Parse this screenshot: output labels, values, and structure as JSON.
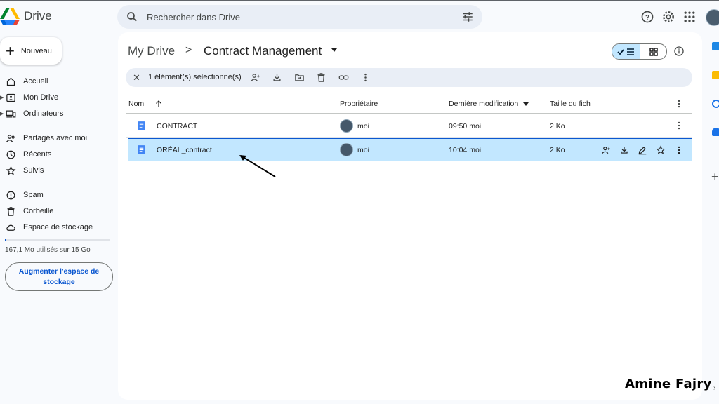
{
  "app": {
    "title": "Drive"
  },
  "search": {
    "placeholder": "Rechercher dans Drive"
  },
  "sidebar": {
    "new_label": "Nouveau",
    "items": [
      {
        "label": "Accueil",
        "icon": "home-icon"
      },
      {
        "label": "Mon Drive",
        "icon": "my-drive-icon"
      },
      {
        "label": "Ordinateurs",
        "icon": "computers-icon"
      },
      {
        "label": "Partagés avec moi",
        "icon": "shared-icon"
      },
      {
        "label": "Récents",
        "icon": "clock-icon"
      },
      {
        "label": "Suivis",
        "icon": "star-icon"
      },
      {
        "label": "Spam",
        "icon": "spam-icon"
      },
      {
        "label": "Corbeille",
        "icon": "trash-icon"
      },
      {
        "label": "Espace de stockage",
        "icon": "cloud-icon"
      }
    ],
    "storage_text": "167,1 Mo utilisés sur 15 Go",
    "storage_used_fraction": 0.011,
    "upgrade_label": "Augmenter l'espace de stockage"
  },
  "breadcrumb": {
    "root": "My Drive",
    "separator": ">",
    "current": "Contract Management"
  },
  "selection_bar": {
    "text": "1 élément(s) sélectionné(s)"
  },
  "table": {
    "headers": {
      "name": "Nom",
      "owner": "Propriétaire",
      "modified": "Dernière modification",
      "size": "Taille du fich"
    },
    "rows": [
      {
        "name": "CONTRACT",
        "owner": "moi",
        "modified": "09:50 moi",
        "size": "2 Ko",
        "selected": false
      },
      {
        "name": "ORÉAL_contract",
        "owner": "moi",
        "modified": "10:04 moi",
        "size": "2 Ko",
        "selected": true
      }
    ]
  },
  "watermark": "Amine Fajry",
  "colors": {
    "accent": "#0b57d0",
    "selected_row": "#c2e7ff",
    "surface": "#f8fafd",
    "chip": "#e9eef6"
  }
}
